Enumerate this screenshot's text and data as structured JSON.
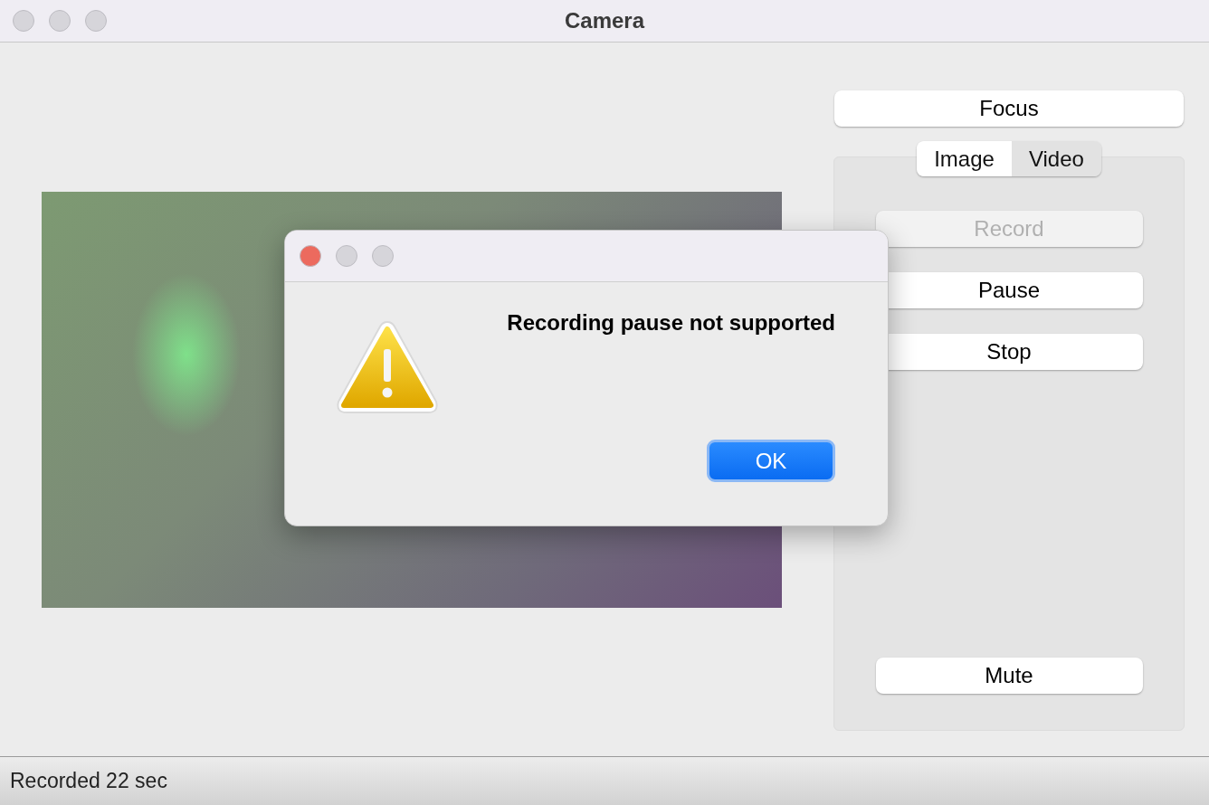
{
  "window": {
    "title": "Camera"
  },
  "focus_button": {
    "label": "Focus"
  },
  "tabs": [
    {
      "label": "Image",
      "selected": true
    },
    {
      "label": "Video",
      "selected": false
    }
  ],
  "controls": [
    {
      "label": "Record",
      "disabled": true
    },
    {
      "label": "Pause",
      "disabled": false
    },
    {
      "label": "Stop",
      "disabled": false
    }
  ],
  "mute_button": {
    "label": "Mute"
  },
  "status_bar": {
    "text": "Recorded 22 sec"
  },
  "dialog": {
    "message": "Recording pause not supported",
    "button": "OK"
  }
}
